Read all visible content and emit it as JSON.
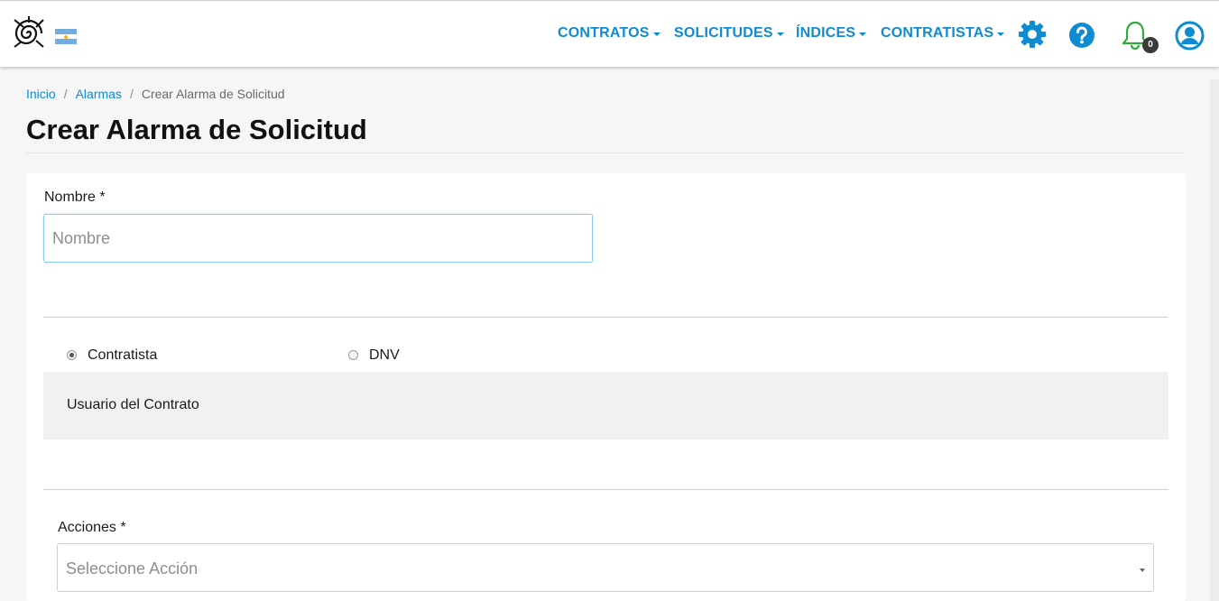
{
  "nav": {
    "items": [
      {
        "label": "CONTRATOS"
      },
      {
        "label": "SOLICITUDES"
      },
      {
        "label": "ÍNDICES"
      },
      {
        "label": "CONTRATISTAS"
      }
    ],
    "notification_count": "0"
  },
  "icons": {
    "settings": "gear-icon",
    "help": "question-circle-icon",
    "notifications": "bell-icon",
    "user": "user-circle-icon",
    "brand_color": "#0e8bd1",
    "bell_color": "#2eaa3c"
  },
  "breadcrumb": {
    "home": "Inicio",
    "alarms": "Alarmas",
    "current": "Crear Alarma de Solicitud"
  },
  "page": {
    "title": "Crear Alarma de Solicitud"
  },
  "form": {
    "name_label": "Nombre *",
    "name_placeholder": "Nombre",
    "name_value": "",
    "radio_contratista": "Contratista",
    "radio_dnv": "DNV",
    "selected_radio": "Contratista",
    "panel_text": "Usuario del Contrato",
    "actions_label": "Acciones *",
    "actions_placeholder": "Seleccione Acción"
  }
}
